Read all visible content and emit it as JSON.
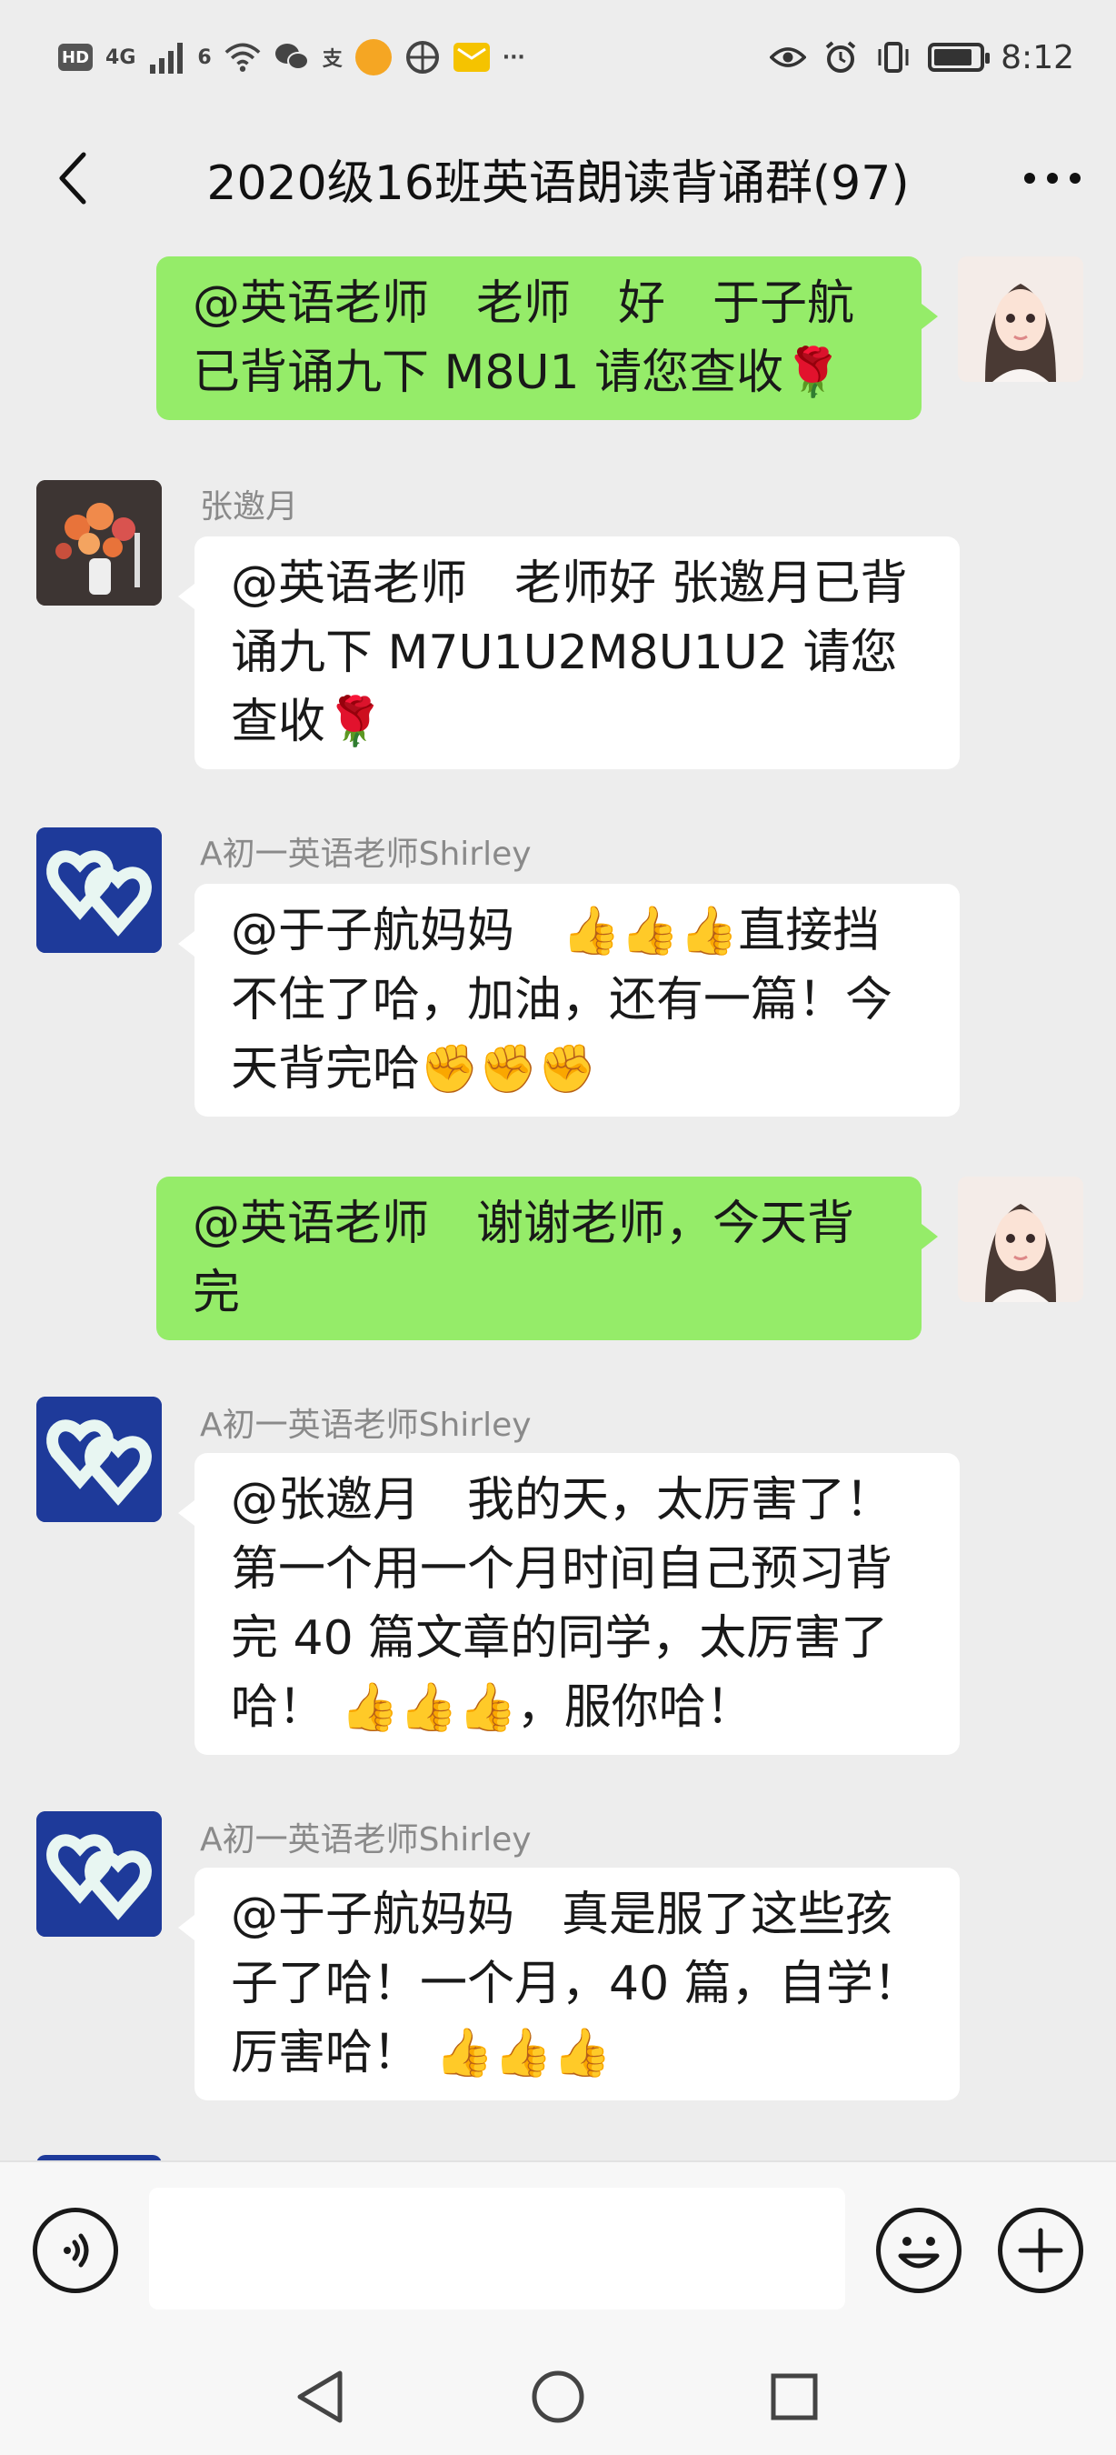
{
  "status_bar": {
    "hd": "HD",
    "network": "4G",
    "wifi_gen": "6",
    "alipay_glyph": "支",
    "more": "···",
    "time": "8:12",
    "battery_level": 0.85
  },
  "header": {
    "title": "2020级16班英语朗读背诵群(97)"
  },
  "messages": [
    {
      "side": "self",
      "text": "@英语老师　老师　好　于子航已背诵九下 M8U1 请您查收🌹"
    },
    {
      "side": "other",
      "sender": "张邀月",
      "text": "@英语老师　老师好 张邀月已背诵九下 M7U1U2M8U1U2 请您查收🌹"
    },
    {
      "side": "other",
      "sender": "A初一英语老师Shirley",
      "text": "@于子航妈妈　👍👍👍直接挡不住了哈，加油，还有一篇！今天背完哈✊✊✊"
    },
    {
      "side": "self",
      "text": "@英语老师　谢谢老师，今天背完"
    },
    {
      "side": "other",
      "sender": "A初一英语老师Shirley",
      "text": "@张邀月　我的天，太厉害了！第一个用一个月时间自己预习背完 40 篇文章的同学，太厉害了哈！ 👍👍👍，服你哈！"
    },
    {
      "side": "other",
      "sender": "A初一英语老师Shirley",
      "text": "@于子航妈妈　真是服了这些孩子了哈！一个月，40 篇，自学！厉害哈！ 👍👍👍"
    }
  ],
  "input": {
    "value": "",
    "placeholder": ""
  },
  "colors": {
    "self_bubble": "#95ec69",
    "other_bubble": "#ffffff",
    "background": "#ededed"
  }
}
